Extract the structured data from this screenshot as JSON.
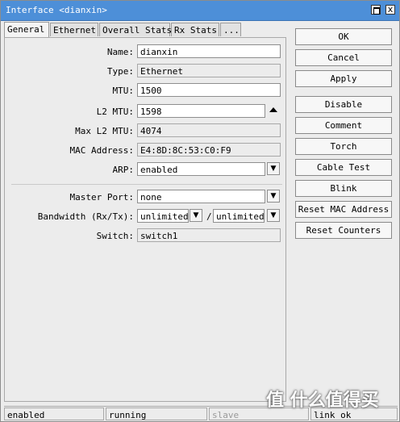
{
  "window": {
    "title": "Interface <dianxin>",
    "maximize_label": "",
    "close_label": "x"
  },
  "tabs": [
    "General",
    "Ethernet",
    "Overall Stats",
    "Rx Stats",
    "..."
  ],
  "form": {
    "name": {
      "label": "Name:",
      "value": "dianxin"
    },
    "type": {
      "label": "Type:",
      "value": "Ethernet"
    },
    "mtu": {
      "label": "MTU:",
      "value": "1500"
    },
    "l2mtu": {
      "label": "L2 MTU:",
      "value": "1598"
    },
    "max_l2mtu": {
      "label": "Max L2 MTU:",
      "value": "4074"
    },
    "mac": {
      "label": "MAC Address:",
      "value": "E4:8D:8C:53:C0:F9"
    },
    "arp": {
      "label": "ARP:",
      "value": "enabled"
    },
    "master_port": {
      "label": "Master Port:",
      "value": "none"
    },
    "bandwidth": {
      "label": "Bandwidth (Rx/Tx):",
      "rx": "unlimited",
      "sep": "/",
      "tx": "unlimited"
    },
    "switch": {
      "label": "Switch:",
      "value": "switch1"
    }
  },
  "buttons": [
    "OK",
    "Cancel",
    "Apply",
    "Disable",
    "Comment",
    "Torch",
    "Cable Test",
    "Blink",
    "Reset MAC Address",
    "Reset Counters"
  ],
  "status": [
    "enabled",
    "running",
    "slave",
    "link ok"
  ],
  "watermark": "值 什么值得买"
}
